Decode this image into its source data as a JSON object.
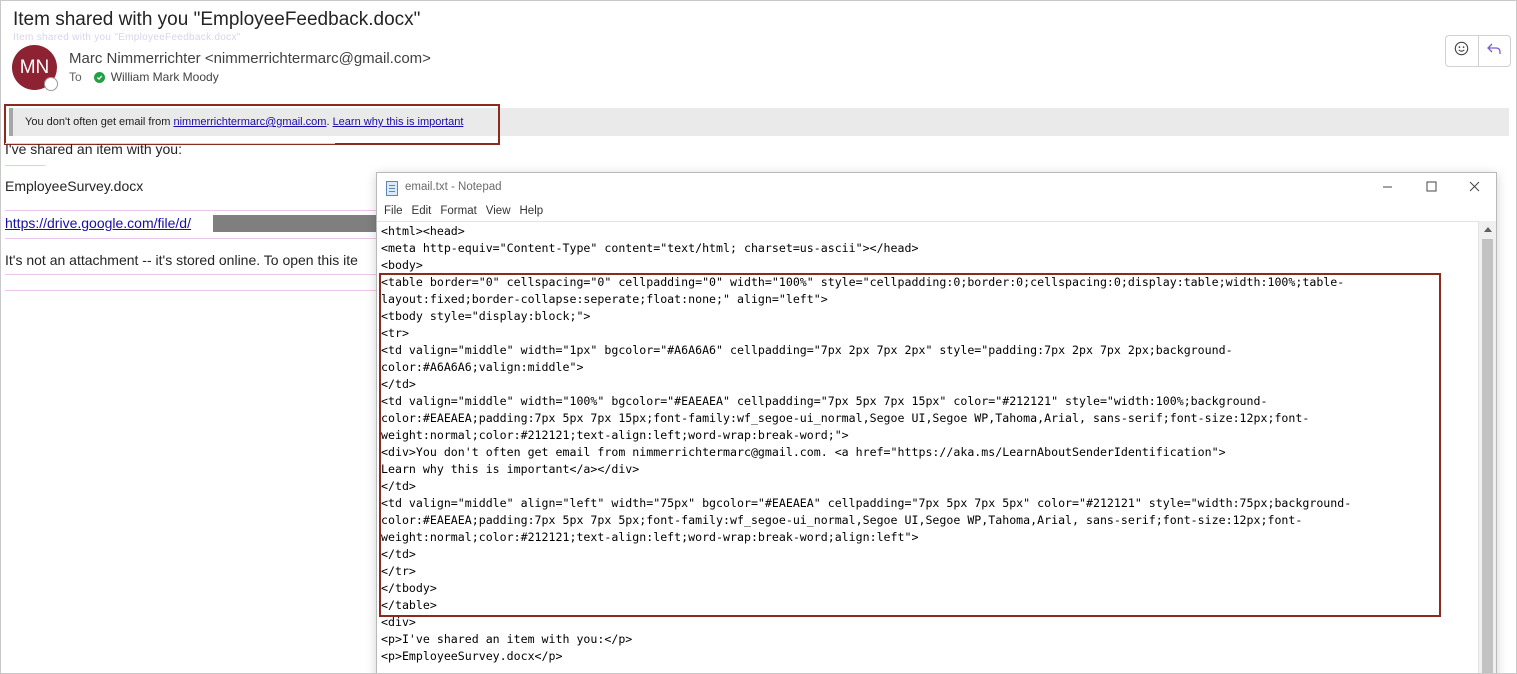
{
  "email": {
    "subject": "Item shared with you \"EmployeeFeedback.docx\"",
    "avatar_initials": "MN",
    "sender": "Marc Nimmerrichter <nimmerrichtermarc@gmail.com>",
    "to_label": "To",
    "recipient": "William Mark Moody",
    "warning_prefix": "You don't often get email from",
    "warning_email": "nimmerrichtermarc@gmail.com",
    "warning_sep": ".",
    "warning_link": "Learn why this is important",
    "shared_text": "I've shared an item with you:",
    "file_name": "EmployeeSurvey.docx",
    "drive_link": "https://drive.google.com/file/d/",
    "attachment_note": "It's not an attachment -- it's stored online. To open this ite"
  },
  "notepad": {
    "title": "email.txt - Notepad",
    "menu": [
      "File",
      "Edit",
      "Format",
      "View",
      "Help"
    ],
    "lines": [
      "<html><head>",
      "<meta http-equiv=\"Content-Type\" content=\"text/html; charset=us-ascii\"></head>",
      "<body>",
      "<table border=\"0\" cellspacing=\"0\" cellpadding=\"0\" width=\"100%\" style=\"cellpadding:0;border:0;cellspacing:0;display:table;width:100%;table-",
      "layout:fixed;border-collapse:seperate;float:none;\" align=\"left\">",
      "<tbody style=\"display:block;\">",
      "<tr>",
      "<td valign=\"middle\" width=\"1px\" bgcolor=\"#A6A6A6\" cellpadding=\"7px 2px 7px 2px\" style=\"padding:7px 2px 7px 2px;background-",
      "color:#A6A6A6;valign:middle\">",
      "</td>",
      "<td valign=\"middle\" width=\"100%\" bgcolor=\"#EAEAEA\" cellpadding=\"7px 5px 7px 15px\" color=\"#212121\" style=\"width:100%;background-",
      "color:#EAEAEA;padding:7px 5px 7px 15px;font-family:wf_segoe-ui_normal,Segoe UI,Segoe WP,Tahoma,Arial, sans-serif;font-size:12px;font-",
      "weight:normal;color:#212121;text-align:left;word-wrap:break-word;\">",
      "<div>You don't often get email from nimmerrichtermarc@gmail.com. <a href=\"https://aka.ms/LearnAboutSenderIdentification\">",
      "Learn why this is important</a></div>",
      "</td>",
      "<td valign=\"middle\" align=\"left\" width=\"75px\" bgcolor=\"#EAEAEA\" cellpadding=\"7px 5px 7px 5px\" color=\"#212121\" style=\"width:75px;background-",
      "color:#EAEAEA;padding:7px 5px 7px 5px;font-family:wf_segoe-ui_normal,Segoe UI,Segoe WP,Tahoma,Arial, sans-serif;font-size:12px;font-",
      "weight:normal;color:#212121;text-align:left;word-wrap:break-word;align:left\">",
      "</td>",
      "</tr>",
      "</tbody>",
      "</table>",
      "<div>",
      "<p>I've shared an item with you:</p>",
      "<p>EmployeeSurvey.docx</p>"
    ]
  },
  "icons": {
    "emoji": "emoji-icon",
    "reply": "reply-icon",
    "minimize": "minimize-icon",
    "maximize": "maximize-icon",
    "close": "close-icon"
  },
  "colors": {
    "avatar_bg": "#8c2232",
    "highlight_border": "#8b2a1f",
    "warning_bg": "#EAEAEA",
    "warning_accent": "#A6A6A6",
    "link": "#1a0dab"
  }
}
